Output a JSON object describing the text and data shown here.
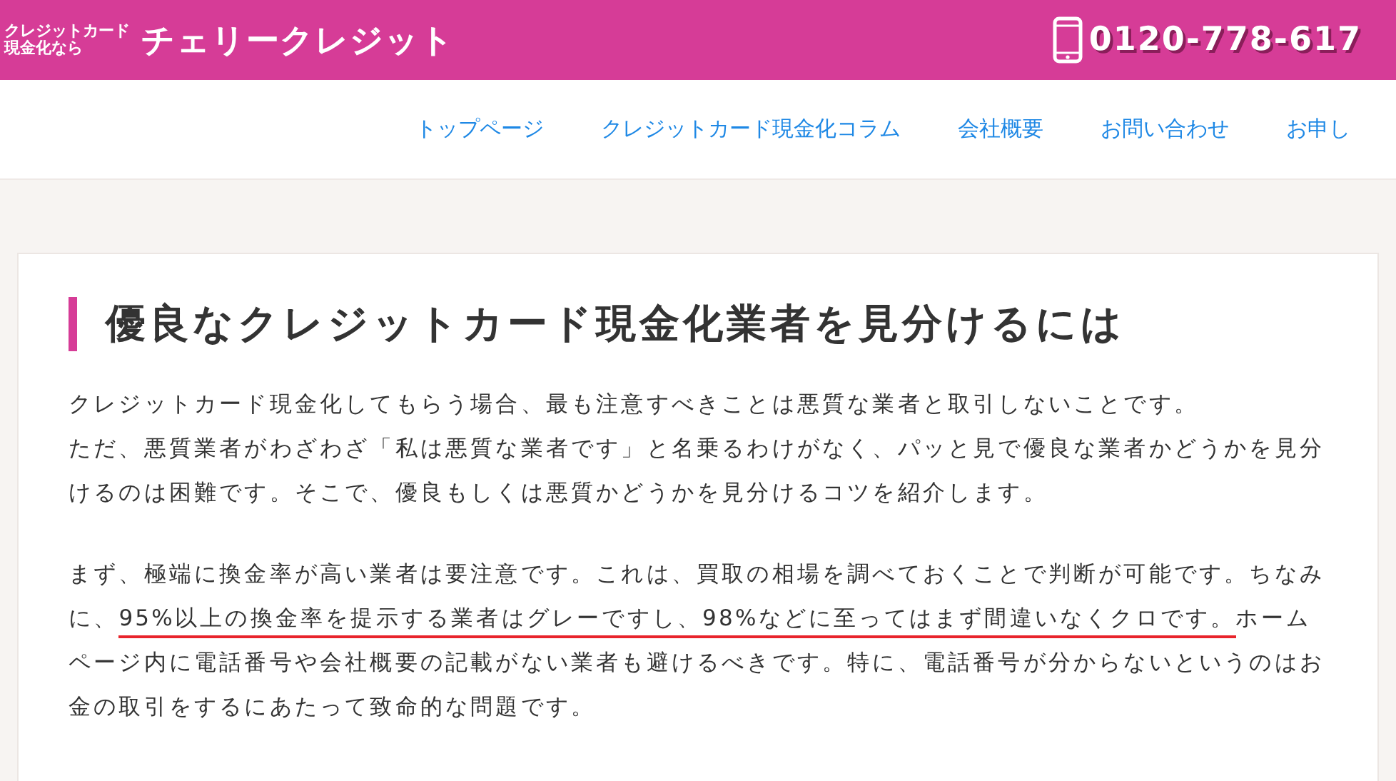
{
  "header": {
    "tagline": [
      "クレジットカード",
      "現金化なら"
    ],
    "site_name": "チェリークレジット",
    "phone": "0120-778-617"
  },
  "nav": {
    "items": [
      "トップページ",
      "クレジットカード現金化コラム",
      "会社概要",
      "お問い合わせ",
      "お申し"
    ]
  },
  "article": {
    "title": "優良なクレジットカード現金化業者を見分けるには",
    "groups": [
      {
        "paragraphs": [
          {
            "segments": [
              {
                "text": "クレジットカード現金化してもらう場合、最も注意すべきことは悪質な業者と取引しないことです。",
                "underlined": false
              }
            ]
          },
          {
            "segments": [
              {
                "text": "ただ、悪質業者がわざわざ「私は悪質な業者です」と名乗るわけがなく、パッと見で優良な業者かどうかを見分けるのは困難です。そこで、優良もしくは悪質かどうかを見分けるコツを紹介します。",
                "underlined": false
              }
            ]
          }
        ]
      },
      {
        "paragraphs": [
          {
            "segments": [
              {
                "text": "まず、極端に換金率が高い業者は要注意です。これは、買取の相場を調べておくことで判断が可能です。ちなみに、",
                "underlined": false
              },
              {
                "text": "95%以上の換金率を提示する業者はグレーですし、98%などに至ってはまず間違いなくクロです。",
                "underlined": true
              },
              {
                "text": "ホームページ内に電話番号や会社概要の記載がない業者も避けるべきです。特に、電話番号が分からないというのはお金の取引をするにあたって致命的な問題です。",
                "underlined": false
              }
            ]
          }
        ]
      }
    ]
  }
}
